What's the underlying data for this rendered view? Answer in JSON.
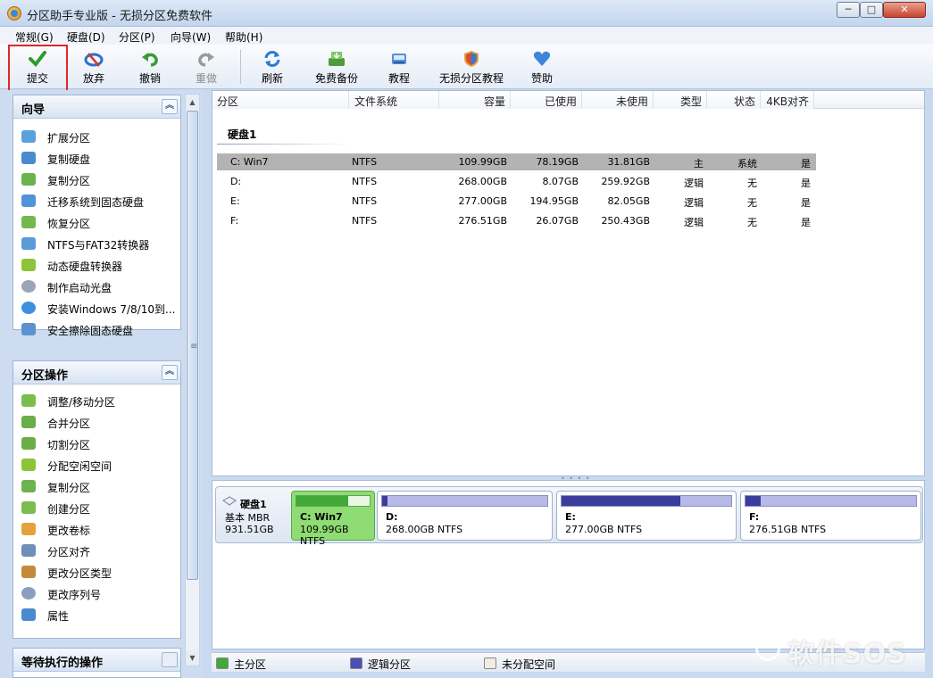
{
  "window": {
    "title": "分区助手专业版 - 无损分区免费软件",
    "min_label": "─",
    "max_label": "□",
    "close_label": "✕"
  },
  "menu": [
    "常规(G)",
    "硬盘(D)",
    "分区(P)",
    "向导(W)",
    "帮助(H)"
  ],
  "toolbar": {
    "submit": "提交",
    "discard": "放弃",
    "undo": "撤销",
    "redo": "重做",
    "refresh": "刷新",
    "backup": "免费备份",
    "tutorial": "教程",
    "lossless_tutorial": "无损分区教程",
    "donate": "赞助"
  },
  "wizard": {
    "title": "向导",
    "items": [
      "扩展分区",
      "复制硬盘",
      "复制分区",
      "迁移系统到固态硬盘",
      "恢复分区",
      "NTFS与FAT32转换器",
      "动态硬盘转换器",
      "制作启动光盘",
      "安装Windows 7/8/10到...",
      "安全擦除固态硬盘"
    ]
  },
  "partition_ops": {
    "title": "分区操作",
    "items": [
      "调整/移动分区",
      "合并分区",
      "切割分区",
      "分配空闲空间",
      "复制分区",
      "创建分区",
      "更改卷标",
      "分区对齐",
      "更改分区类型",
      "更改序列号",
      "属性"
    ]
  },
  "pending": {
    "title": "等待执行的操作"
  },
  "columns": [
    "分区",
    "文件系统",
    "容量",
    "已使用",
    "未使用",
    "类型",
    "状态",
    "4KB对齐"
  ],
  "disk": {
    "name": "硬盘1",
    "type": "基本 MBR",
    "size": "931.51GB",
    "partitions": [
      {
        "name": "C: Win7",
        "fs": "NTFS",
        "capacity": "109.99GB",
        "used": "78.19GB",
        "free": "31.81GB",
        "type": "主",
        "status": "系统",
        "align": "是",
        "used_fraction": 0.71,
        "map_label": "C: Win7",
        "map_size": "109.99GB NTFS"
      },
      {
        "name": "D:",
        "fs": "NTFS",
        "capacity": "268.00GB",
        "used": "8.07GB",
        "free": "259.92GB",
        "type": "逻辑",
        "status": "无",
        "align": "是",
        "used_fraction": 0.03,
        "map_label": "D:",
        "map_size": "268.00GB NTFS"
      },
      {
        "name": "E:",
        "fs": "NTFS",
        "capacity": "277.00GB",
        "used": "194.95GB",
        "free": "82.05GB",
        "type": "逻辑",
        "status": "无",
        "align": "是",
        "used_fraction": 0.7,
        "map_label": "E:",
        "map_size": "277.00GB NTFS"
      },
      {
        "name": "F:",
        "fs": "NTFS",
        "capacity": "276.51GB",
        "used": "26.07GB",
        "free": "250.43GB",
        "type": "逻辑",
        "status": "无",
        "align": "是",
        "used_fraction": 0.09,
        "map_label": "F:",
        "map_size": "276.51GB NTFS"
      }
    ]
  },
  "legend": {
    "primary": "主分区",
    "logical": "逻辑分区",
    "unallocated": "未分配空间",
    "primary_color": "#41a93a",
    "logical_color": "#4b4fb4",
    "unallocated_color": "#f2ece2"
  },
  "watermark": "软件SOS",
  "colors": {
    "highlight": "#e0262b",
    "selected_row": "#b3b3b3"
  }
}
